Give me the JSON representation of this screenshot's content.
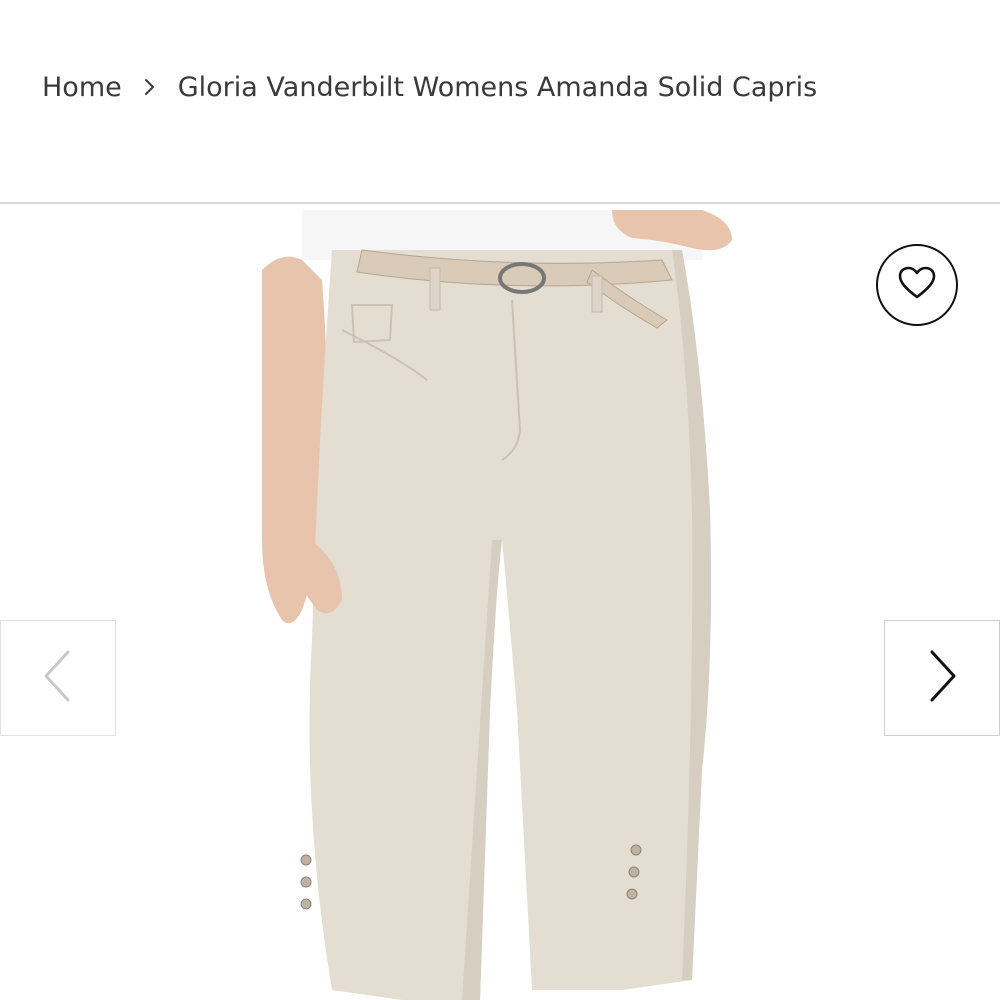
{
  "breadcrumb": {
    "home_label": "Home",
    "separator_icon": "chevron-right-icon",
    "current_label": "Gloria Vanderbilt Womens Amanda Solid Capris"
  },
  "gallery": {
    "image_alt": "Gloria Vanderbilt Womens Amanda Solid Capris",
    "wishlist_icon": "heart-icon",
    "prev_icon": "chevron-left-icon",
    "next_icon": "chevron-right-icon"
  },
  "colors": {
    "text": "#3a3a3a",
    "divider": "#d8d8d8",
    "pants": "#e4ddd2",
    "skin": "#e9c4ad",
    "belt": "#d9cbb8"
  }
}
